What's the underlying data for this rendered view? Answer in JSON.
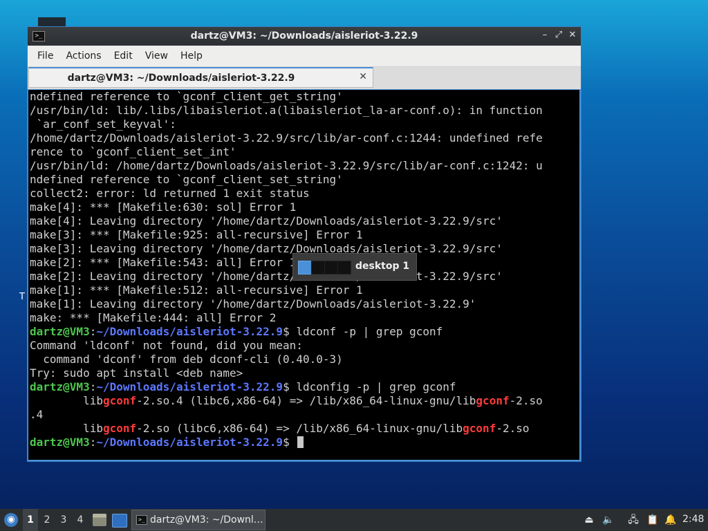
{
  "desktop": {
    "stray_text": "T"
  },
  "window": {
    "title": "dartz@VM3: ~/Downloads/aisleriot-3.22.9",
    "app_icon": "terminal-icon",
    "controls": {
      "minimize": "–",
      "maximize": "⤢",
      "close": "✕"
    }
  },
  "menu": [
    "File",
    "Actions",
    "Edit",
    "View",
    "Help"
  ],
  "tab": {
    "title": "dartz@VM3: ~/Downloads/aisleriot-3.22.9",
    "close": "✕"
  },
  "terminal": {
    "colors": {
      "user": "#4ec64e",
      "path": "#5c78ff",
      "match": "#ff3b3b",
      "text": "#d0d0d0"
    },
    "lines": [
      [
        {
          "t": "ndefined reference to `gconf_client_get_string'"
        }
      ],
      [
        {
          "t": "/usr/bin/ld: lib/.libs/libaisleriot.a(libaisleriot_la-ar-conf.o): in function"
        }
      ],
      [
        {
          "t": " `ar_conf_set_keyval':"
        }
      ],
      [
        {
          "t": "/home/dartz/Downloads/aisleriot-3.22.9/src/lib/ar-conf.c:1244: undefined refe"
        }
      ],
      [
        {
          "t": "rence to `gconf_client_set_int'"
        }
      ],
      [
        {
          "t": "/usr/bin/ld: /home/dartz/Downloads/aisleriot-3.22.9/src/lib/ar-conf.c:1242: u"
        }
      ],
      [
        {
          "t": "ndefined reference to `gconf_client_set_string'"
        }
      ],
      [
        {
          "t": "collect2: error: ld returned 1 exit status"
        }
      ],
      [
        {
          "t": "make[4]: *** [Makefile:630: sol] Error 1"
        }
      ],
      [
        {
          "t": "make[4]: Leaving directory '/home/dartz/Downloads/aisleriot-3.22.9/src'"
        }
      ],
      [
        {
          "t": "make[3]: *** [Makefile:925: all-recursive] Error 1"
        }
      ],
      [
        {
          "t": "make[3]: Leaving directory '/home/dartz/Downloads/aisleriot-3.22.9/src'"
        }
      ],
      [
        {
          "t": "make[2]: *** [Makefile:543: all] Error 1"
        }
      ],
      [
        {
          "t": "make[2]: Leaving directory '/home/dartz/Downloads/aisleriot-3.22.9/src'"
        }
      ],
      [
        {
          "t": "make[1]: *** [Makefile:512: all-recursive] Error 1"
        }
      ],
      [
        {
          "t": "make[1]: Leaving directory '/home/dartz/Downloads/aisleriot-3.22.9'"
        }
      ],
      [
        {
          "t": "make: *** [Makefile:444: all] Error 2"
        }
      ],
      [
        {
          "t": "dartz@VM3",
          "c": "g"
        },
        {
          "t": ":"
        },
        {
          "t": "~/Downloads/aisleriot-3.22.9",
          "c": "b"
        },
        {
          "t": "$ ldconf -p | grep gconf"
        }
      ],
      [
        {
          "t": "Command 'ldconf' not found, did you mean:"
        }
      ],
      [
        {
          "t": "  command 'dconf' from deb dconf-cli (0.40.0-3)"
        }
      ],
      [
        {
          "t": "Try: sudo apt install <deb name>"
        }
      ],
      [
        {
          "t": "dartz@VM3",
          "c": "g"
        },
        {
          "t": ":"
        },
        {
          "t": "~/Downloads/aisleriot-3.22.9",
          "c": "b"
        },
        {
          "t": "$ ldconfig -p | grep gconf"
        }
      ],
      [
        {
          "t": "        lib"
        },
        {
          "t": "gconf",
          "c": "r"
        },
        {
          "t": "-2.so.4 (libc6,x86-64) => /lib/x86_64-linux-gnu/lib"
        },
        {
          "t": "gconf",
          "c": "r"
        },
        {
          "t": "-2.so"
        }
      ],
      [
        {
          "t": ".4"
        }
      ],
      [
        {
          "t": "        lib"
        },
        {
          "t": "gconf",
          "c": "r"
        },
        {
          "t": "-2.so (libc6,x86-64) => /lib/x86_64-linux-gnu/lib"
        },
        {
          "t": "gconf",
          "c": "r"
        },
        {
          "t": "-2.so"
        }
      ],
      [
        {
          "t": "dartz@VM3",
          "c": "g"
        },
        {
          "t": ":"
        },
        {
          "t": "~/Downloads/aisleriot-3.22.9",
          "c": "b"
        },
        {
          "t": "$ "
        },
        {
          "cursor": true
        }
      ]
    ]
  },
  "osd": {
    "label": "desktop 1",
    "workspaces": 4,
    "active_index": 0
  },
  "taskbar": {
    "start_icon": "start-menu-icon",
    "workspaces": [
      "1",
      "2",
      "3",
      "4"
    ],
    "active_workspace": "1",
    "task_label": "dartz@VM3: ~/Downl…",
    "tray_icons": [
      "eject-icon",
      "volume-icon",
      "network-icon",
      "clipboard-icon",
      "notification-icon"
    ],
    "clock": "2:48"
  }
}
